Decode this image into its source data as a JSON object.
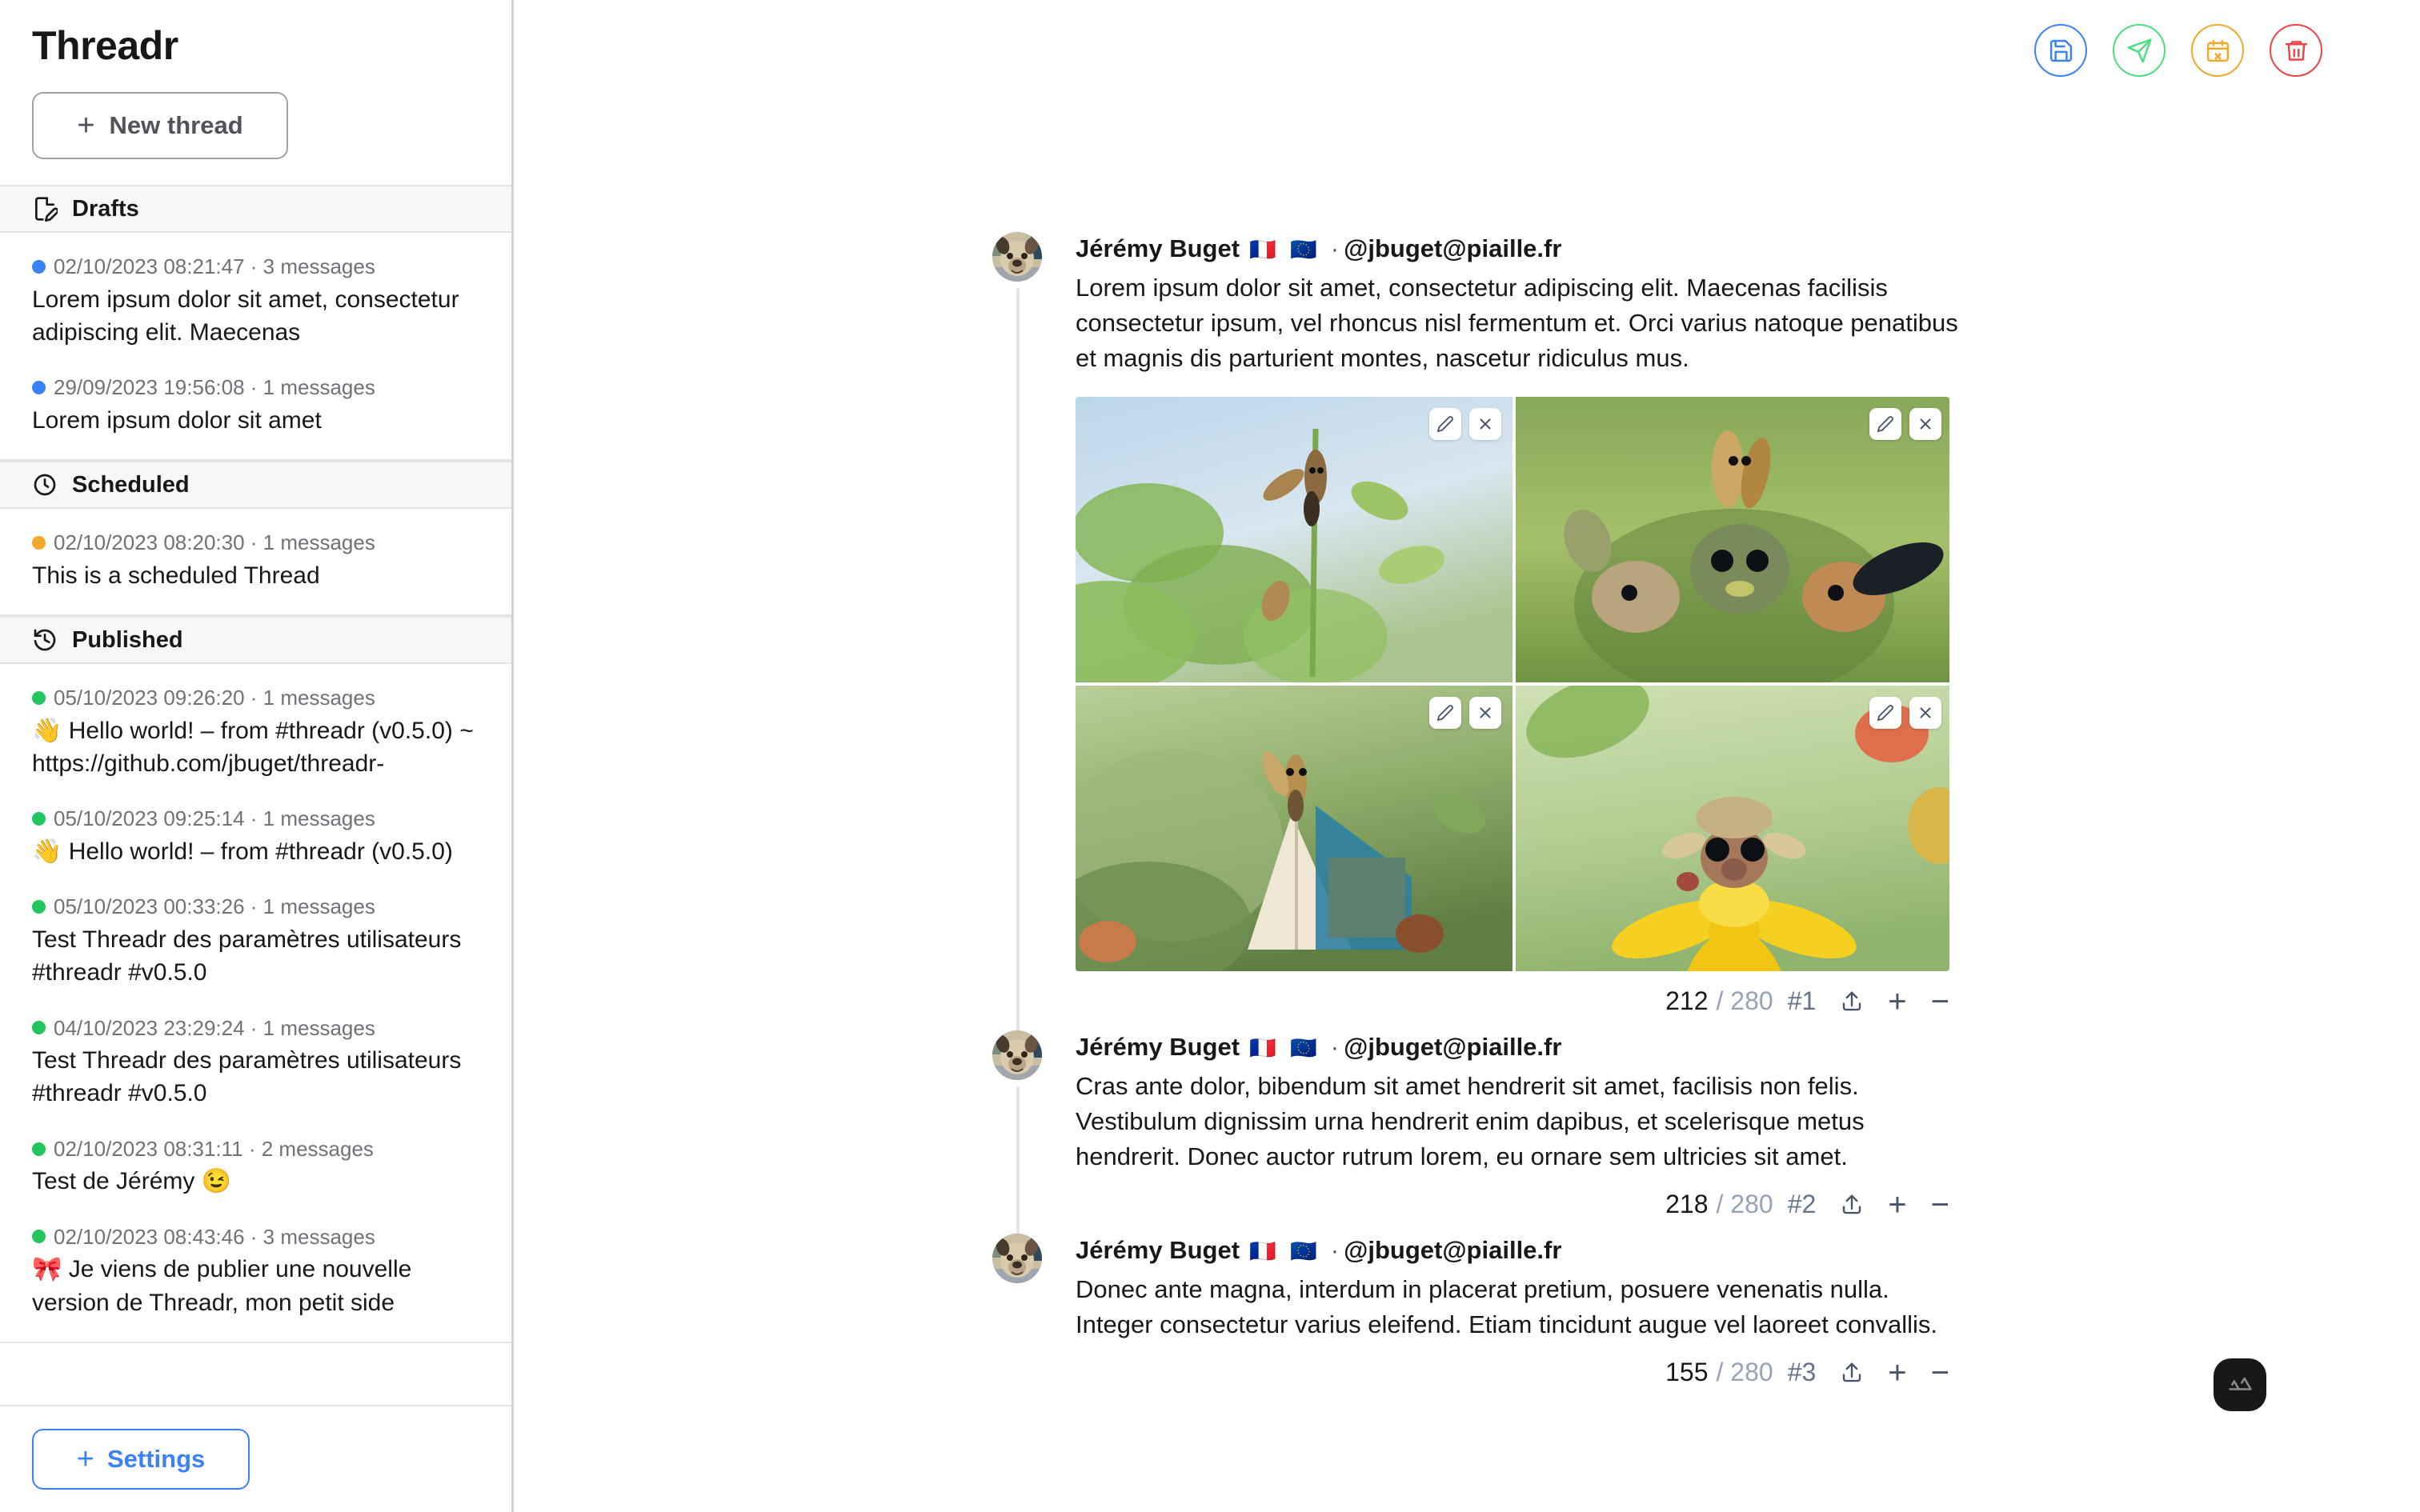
{
  "app": {
    "title": "Threadr"
  },
  "sidebar": {
    "new_thread_label": "New thread",
    "settings_label": "Settings",
    "plus_glyph": "+",
    "sections": [
      {
        "id": "drafts",
        "label": "Drafts",
        "icon": "file-edit-icon",
        "dot_color": "#3b82f6",
        "items": [
          {
            "meta": "02/10/2023 08:21:47 · 3 messages",
            "preview": "Lorem ipsum dolor sit amet, consectetur adipiscing elit. Maecenas"
          },
          {
            "meta": "29/09/2023 19:56:08 · 1 messages",
            "preview": "Lorem ipsum dolor sit amet"
          }
        ]
      },
      {
        "id": "scheduled",
        "label": "Scheduled",
        "icon": "clock-icon",
        "dot_color": "#f0a929",
        "items": [
          {
            "meta": "02/10/2023 08:20:30 · 1 messages",
            "preview": "This is a scheduled Thread"
          }
        ]
      },
      {
        "id": "published",
        "label": "Published",
        "icon": "history-icon",
        "dot_color": "#22c55e",
        "items": [
          {
            "meta": "05/10/2023 09:26:20 · 1 messages",
            "preview": "👋 Hello world! – from #threadr (v0.5.0) ~ https://github.com/jbuget/threadr-"
          },
          {
            "meta": "05/10/2023 09:25:14 · 1 messages",
            "preview": "👋 Hello world! – from #threadr (v0.5.0)"
          },
          {
            "meta": "05/10/2023 00:33:26 · 1 messages",
            "preview": "Test Threadr des paramètres utilisateurs #threadr #v0.5.0"
          },
          {
            "meta": "04/10/2023 23:29:24 · 1 messages",
            "preview": "Test Threadr des paramètres utilisateurs #threadr #v0.5.0"
          },
          {
            "meta": "02/10/2023 08:31:11 · 2 messages",
            "preview": "Test de Jérémy 😉"
          },
          {
            "meta": "02/10/2023 08:43:46 · 3 messages",
            "preview": "🎀 Je viens de publier une nouvelle version de Threadr, mon petit side"
          }
        ]
      }
    ]
  },
  "toolbar": {
    "buttons": [
      {
        "name": "save-button",
        "icon": "floppy-disk-icon",
        "color": "#3b82f6"
      },
      {
        "name": "send-button",
        "icon": "paper-plane-icon",
        "color": "#4ade80"
      },
      {
        "name": "schedule-button",
        "icon": "calendar-x-icon",
        "color": "#f0a929"
      },
      {
        "name": "delete-button",
        "icon": "trash-icon",
        "color": "#ef4444"
      }
    ]
  },
  "thread": {
    "author": {
      "name": "Jérémy Buget",
      "flags": "🇫🇷 🇪🇺",
      "separator": "·",
      "handle": "@jbuget@piaille.fr"
    },
    "counter_max": "280",
    "media_edit_label": "edit",
    "media_remove_label": "remove",
    "posts": [
      {
        "text": "Lorem ipsum dolor sit amet, consectetur adipiscing elit. Maecenas facilisis consectetur ipsum, vel rhoncus nisl fermentum et. Orci varius natoque penatibus et magnis dis parturient montes, nascetur ridiculus mus.",
        "count": "212",
        "index": "#1",
        "media": [
          {
            "alt": "seed-creature-on-leafy-branch-against-sky"
          },
          {
            "alt": "group-of-seed-creatures-in-grass"
          },
          {
            "alt": "seed-creature-reading-book-in-moss"
          },
          {
            "alt": "seed-creature-on-yellow-sunflower"
          }
        ]
      },
      {
        "text": "Cras ante dolor, bibendum sit amet hendrerit sit amet, facilisis non felis. Vestibulum dignissim urna hendrerit enim dapibus, et scelerisque metus hendrerit. Donec auctor rutrum lorem, eu ornare sem ultricies sit amet.",
        "count": "218",
        "index": "#2",
        "media": []
      },
      {
        "text": "Donec ante magna, interdum in placerat pretium, posuere venenatis nulla. Integer consectetur varius eleifend. Etiam tincidunt augue vel laoreet convallis.",
        "count": "155",
        "index": "#3",
        "media": []
      }
    ]
  },
  "devtools": {
    "icon": "nuxt-logo-icon"
  }
}
